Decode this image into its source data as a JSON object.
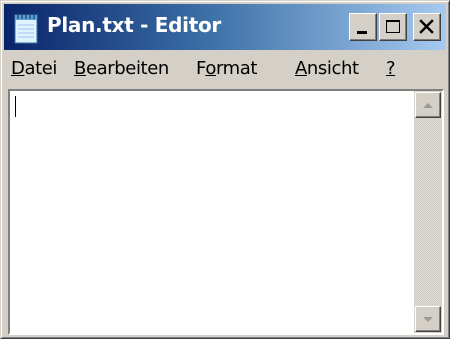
{
  "window": {
    "title": "Plan.txt - Editor",
    "icon": "notepad-icon"
  },
  "titlebar_buttons": {
    "minimize_icon": "minimize-icon",
    "maximize_icon": "maximize-icon",
    "close_icon": "close-icon"
  },
  "menu": {
    "items": [
      {
        "accel": "D",
        "rest": "atei"
      },
      {
        "accel": "B",
        "rest": "earbeiten"
      },
      {
        "pre": "F",
        "accel": "o",
        "rest": "rmat"
      },
      {
        "accel": "A",
        "rest": "nsicht"
      },
      {
        "accel": "?",
        "rest": ""
      }
    ]
  },
  "editor": {
    "content": ""
  },
  "colors": {
    "title_active_start": "#0a246a",
    "title_active_end": "#a6caf0",
    "face": "#d4d0c8"
  }
}
